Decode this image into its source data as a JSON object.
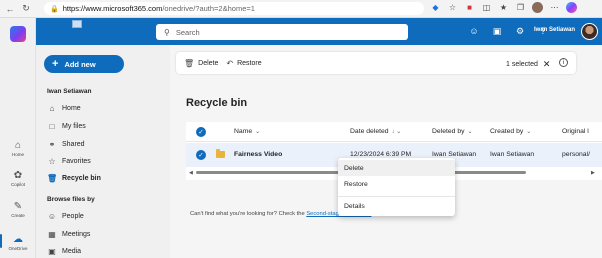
{
  "browser": {
    "url_domain": "https://www.microsoft365.com",
    "url_path": "/onedrive/?auth=2&home=1"
  },
  "header": {
    "search_placeholder": "Search",
    "user_name": "Iwan Setiawan"
  },
  "rail": {
    "items": [
      {
        "label": "Home",
        "icon": "home-icon"
      },
      {
        "label": "Copilot",
        "icon": "copilot-icon"
      },
      {
        "label": "Create",
        "icon": "create-icon"
      },
      {
        "label": "OneDrive",
        "icon": "onedrive-icon"
      }
    ]
  },
  "sidebar": {
    "add_new_label": "Add new",
    "section_user": "Iwan Setiawan",
    "items": [
      {
        "label": "Home",
        "icon": "home-icon"
      },
      {
        "label": "My files",
        "icon": "folder-icon"
      },
      {
        "label": "Shared",
        "icon": "shared-icon"
      },
      {
        "label": "Favorites",
        "icon": "star-icon"
      },
      {
        "label": "Recycle bin",
        "icon": "trash-icon",
        "selected": true
      }
    ],
    "section_browse": "Browse files by",
    "browse_items": [
      {
        "label": "People",
        "icon": "person-icon"
      },
      {
        "label": "Meetings",
        "icon": "calendar-icon"
      },
      {
        "label": "Media",
        "icon": "image-icon"
      }
    ]
  },
  "commandbar": {
    "delete_label": "Delete",
    "restore_label": "Restore",
    "selected_label": "1 selected"
  },
  "main": {
    "title": "Recycle bin",
    "columns": [
      "Name",
      "Date deleted",
      "Deleted by",
      "Created by",
      "Original l"
    ],
    "rows": [
      {
        "name": "Fairness Video",
        "date_deleted": "12/23/2024 6:39 PM",
        "deleted_by": "Iwan Setiawan",
        "created_by": "Iwan Setiawan",
        "original_location": "personal/"
      }
    ],
    "cant_find_text": "Can't find what you're looking for? Check the",
    "cant_find_link": "Second-stage recycle bin"
  },
  "context_menu": {
    "items": [
      "Delete",
      "Restore",
      "Details"
    ]
  },
  "colors": {
    "accent": "#0f6cbd",
    "selected_row": "#eaf1fb"
  }
}
